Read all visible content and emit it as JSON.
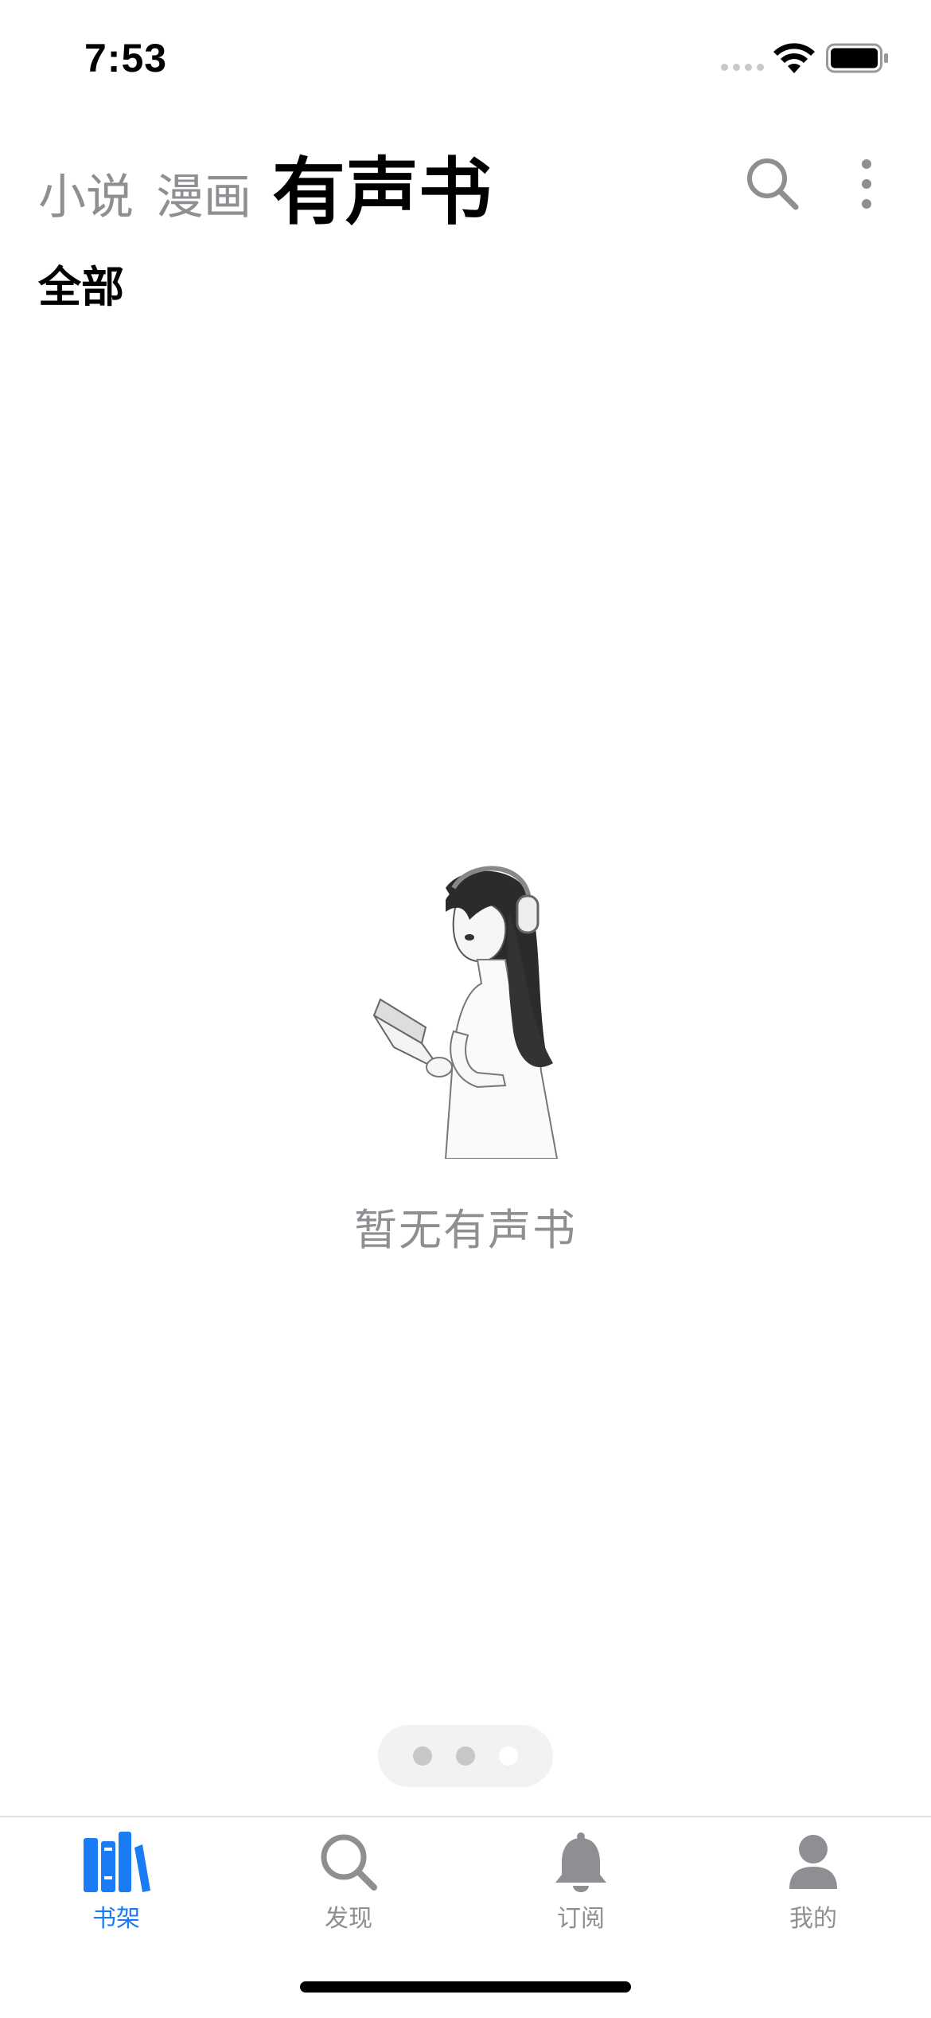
{
  "status_bar": {
    "time": "7:53"
  },
  "header": {
    "tabs": [
      {
        "label": "小说",
        "active": false
      },
      {
        "label": "漫画",
        "active": false
      },
      {
        "label": "有声书",
        "active": true
      }
    ],
    "icons": [
      "search-icon",
      "more-vertical-icon"
    ]
  },
  "section": {
    "label": "全部"
  },
  "empty_state": {
    "message": "暂无有声书",
    "illustration": "girl-reading-with-headphones"
  },
  "page_indicator": {
    "count": 3,
    "current_index": 2
  },
  "tab_bar": {
    "items": [
      {
        "label": "书架",
        "icon": "bookshelf-icon",
        "active": true
      },
      {
        "label": "发现",
        "icon": "search-icon",
        "active": false
      },
      {
        "label": "订阅",
        "icon": "bell-icon",
        "active": false
      },
      {
        "label": "我的",
        "icon": "person-icon",
        "active": false
      }
    ]
  },
  "colors": {
    "accent": "#1a7cf5",
    "inactive": "#8e8e93",
    "text": "#000000"
  }
}
